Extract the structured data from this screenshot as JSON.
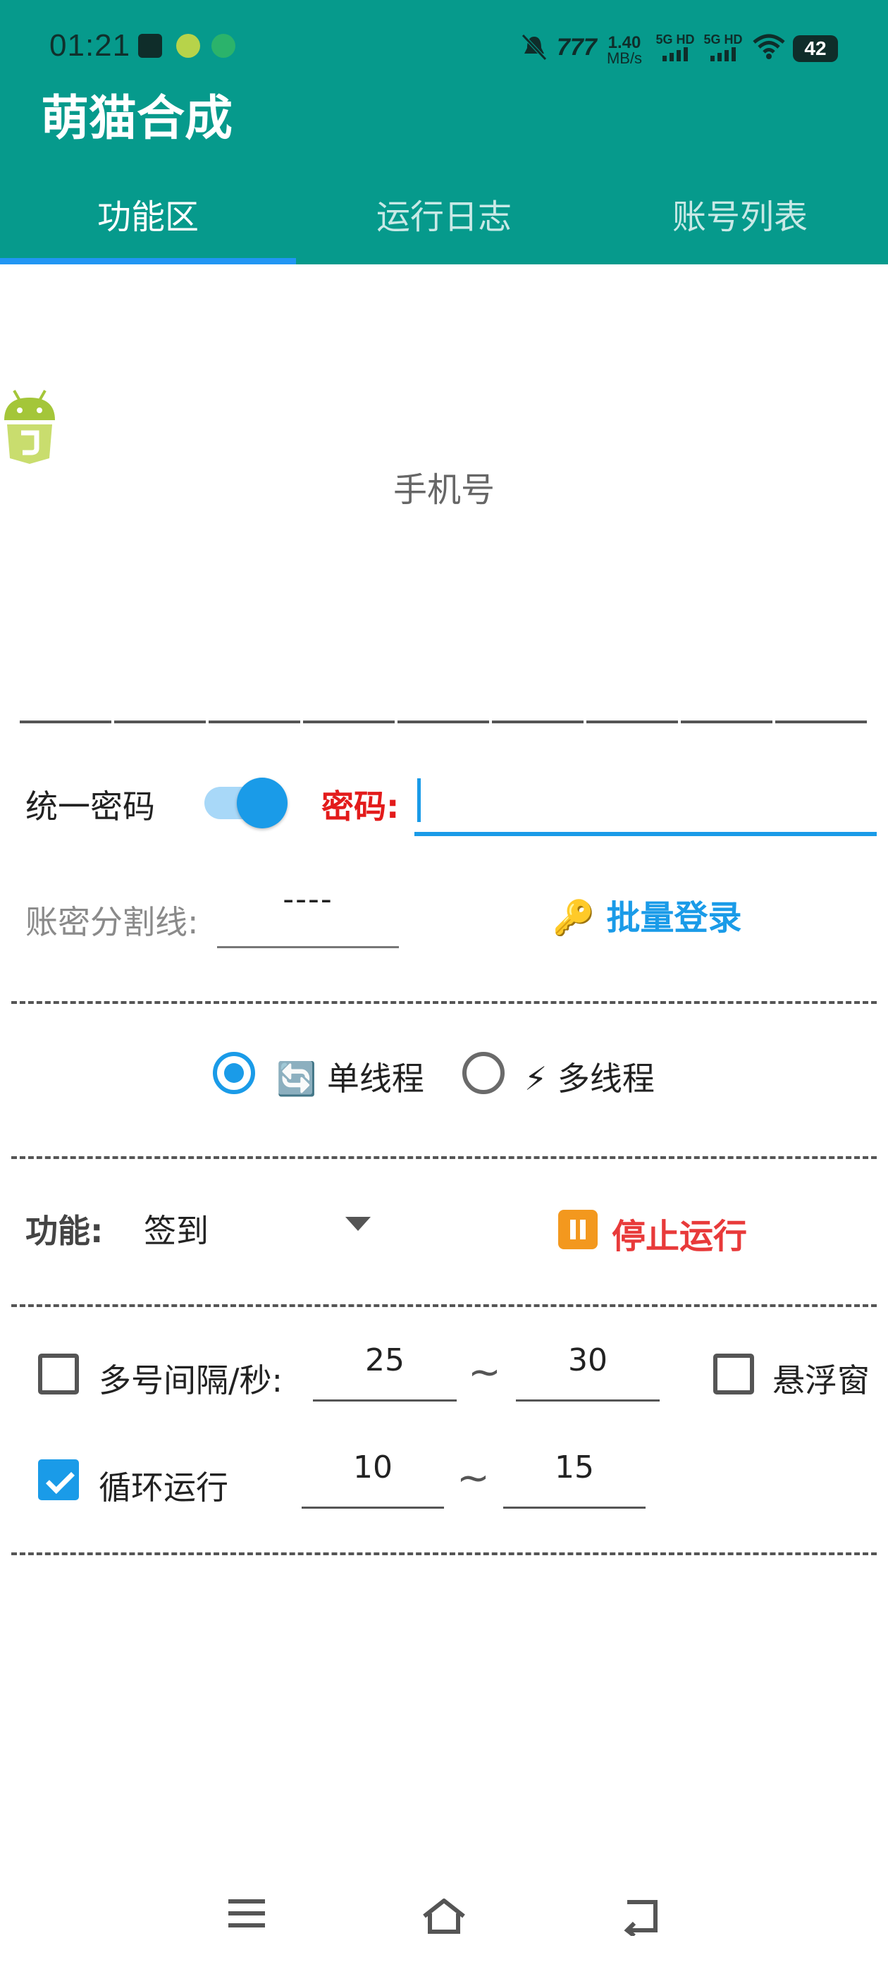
{
  "status_bar": {
    "time": "01:21",
    "net_speed_value": "1.40",
    "net_speed_unit": "MB/s",
    "sim1": "5G HD",
    "sim2": "5G HD",
    "battery": "42"
  },
  "app": {
    "title": "萌猫合成"
  },
  "tabs": [
    {
      "label": "功能区",
      "active": true
    },
    {
      "label": "运行日志",
      "active": false
    },
    {
      "label": "账号列表",
      "active": false
    }
  ],
  "phone_field": {
    "placeholder": "手机号"
  },
  "password_row": {
    "unified_label": "统一密码",
    "unified_enabled": true,
    "password_label": "密码:",
    "password_value": ""
  },
  "separator_row": {
    "label": "账密分割线:",
    "value": "----",
    "batch_login_label": "🔑 批量登录"
  },
  "thread_mode": {
    "options": [
      {
        "label": "🔄 单线程",
        "selected": true
      },
      {
        "label": "⚡ 多线程",
        "selected": false
      }
    ]
  },
  "function_row": {
    "label": "功能:",
    "selected": "签到",
    "stop_label": "停止运行"
  },
  "interval_row": {
    "label": "多号间隔/秒:",
    "checked": false,
    "min": "25",
    "tilde": "~",
    "max": "30",
    "float_label": "悬浮窗",
    "float_checked": false
  },
  "loop_row": {
    "label": "循环运行",
    "checked": true,
    "min": "10",
    "tilde": "~",
    "max": "15"
  },
  "colors": {
    "header": "#069a8c",
    "accent": "#1a9be8",
    "danger": "#e31b1b",
    "stop_icon": "#f3981e"
  },
  "nav_bar": [
    "menu-icon",
    "home-icon",
    "back-icon"
  ]
}
